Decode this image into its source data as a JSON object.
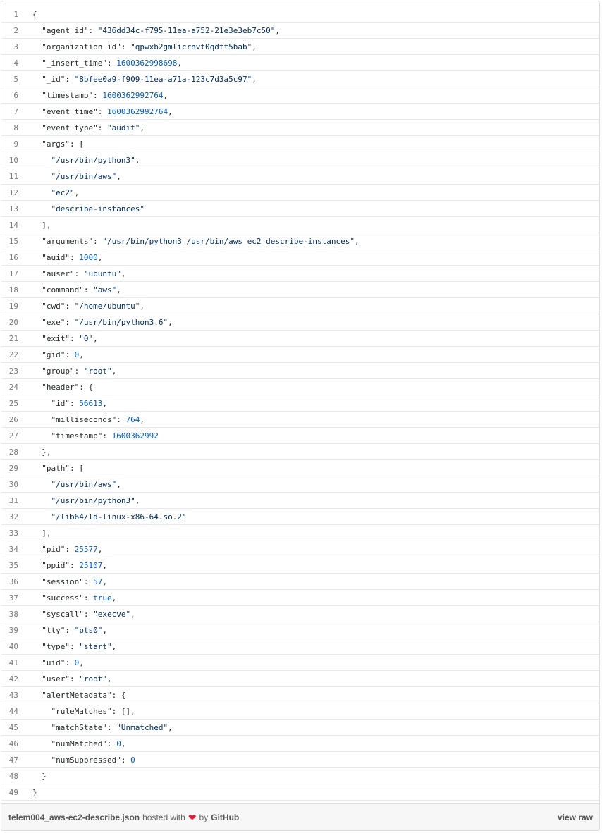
{
  "lines": [
    {
      "n": "1",
      "text": "{"
    },
    {
      "n": "2",
      "text": "  \"agent_id\": \"436dd34c-f795-11ea-a752-21e3e3eb7c50\","
    },
    {
      "n": "3",
      "text": "  \"organization_id\": \"qpwxb2gmlicrnvt0qdtt5bab\","
    },
    {
      "n": "4",
      "text": "  \"_insert_time\": 1600362998698,"
    },
    {
      "n": "5",
      "text": "  \"_id\": \"8bfee0a9-f909-11ea-a71a-123c7d3a5c97\","
    },
    {
      "n": "6",
      "text": "  \"timestamp\": 1600362992764,"
    },
    {
      "n": "7",
      "text": "  \"event_time\": 1600362992764,"
    },
    {
      "n": "8",
      "text": "  \"event_type\": \"audit\","
    },
    {
      "n": "9",
      "text": "  \"args\": ["
    },
    {
      "n": "10",
      "text": "    \"/usr/bin/python3\","
    },
    {
      "n": "11",
      "text": "    \"/usr/bin/aws\","
    },
    {
      "n": "12",
      "text": "    \"ec2\","
    },
    {
      "n": "13",
      "text": "    \"describe-instances\""
    },
    {
      "n": "14",
      "text": "  ],"
    },
    {
      "n": "15",
      "text": "  \"arguments\": \"/usr/bin/python3 /usr/bin/aws ec2 describe-instances\","
    },
    {
      "n": "16",
      "text": "  \"auid\": 1000,"
    },
    {
      "n": "17",
      "text": "  \"auser\": \"ubuntu\","
    },
    {
      "n": "18",
      "text": "  \"command\": \"aws\","
    },
    {
      "n": "19",
      "text": "  \"cwd\": \"/home/ubuntu\","
    },
    {
      "n": "20",
      "text": "  \"exe\": \"/usr/bin/python3.6\","
    },
    {
      "n": "21",
      "text": "  \"exit\": \"0\","
    },
    {
      "n": "22",
      "text": "  \"gid\": 0,"
    },
    {
      "n": "23",
      "text": "  \"group\": \"root\","
    },
    {
      "n": "24",
      "text": "  \"header\": {"
    },
    {
      "n": "25",
      "text": "    \"id\": 56613,"
    },
    {
      "n": "26",
      "text": "    \"milliseconds\": 764,"
    },
    {
      "n": "27",
      "text": "    \"timestamp\": 1600362992"
    },
    {
      "n": "28",
      "text": "  },"
    },
    {
      "n": "29",
      "text": "  \"path\": ["
    },
    {
      "n": "30",
      "text": "    \"/usr/bin/aws\","
    },
    {
      "n": "31",
      "text": "    \"/usr/bin/python3\","
    },
    {
      "n": "32",
      "text": "    \"/lib64/ld-linux-x86-64.so.2\""
    },
    {
      "n": "33",
      "text": "  ],"
    },
    {
      "n": "34",
      "text": "  \"pid\": 25577,"
    },
    {
      "n": "35",
      "text": "  \"ppid\": 25107,"
    },
    {
      "n": "36",
      "text": "  \"session\": 57,"
    },
    {
      "n": "37",
      "text": "  \"success\": true,"
    },
    {
      "n": "38",
      "text": "  \"syscall\": \"execve\","
    },
    {
      "n": "39",
      "text": "  \"tty\": \"pts0\","
    },
    {
      "n": "40",
      "text": "  \"type\": \"start\","
    },
    {
      "n": "41",
      "text": "  \"uid\": 0,"
    },
    {
      "n": "42",
      "text": "  \"user\": \"root\","
    },
    {
      "n": "43",
      "text": "  \"alertMetadata\": {"
    },
    {
      "n": "44",
      "text": "    \"ruleMatches\": [],"
    },
    {
      "n": "45",
      "text": "    \"matchState\": \"Unmatched\","
    },
    {
      "n": "46",
      "text": "    \"numMatched\": 0,"
    },
    {
      "n": "47",
      "text": "    \"numSuppressed\": 0"
    },
    {
      "n": "48",
      "text": "  }"
    },
    {
      "n": "49",
      "text": "}"
    }
  ],
  "footer": {
    "filename": "telem004_aws-ec2-describe.json",
    "hosted_with": "hosted with",
    "heart_icon": "heart-icon",
    "by": "by",
    "github": "GitHub",
    "view_raw": "view raw"
  },
  "colors": {
    "string": "#032f62",
    "number": "#005cc5",
    "heart": "#d9243b"
  }
}
